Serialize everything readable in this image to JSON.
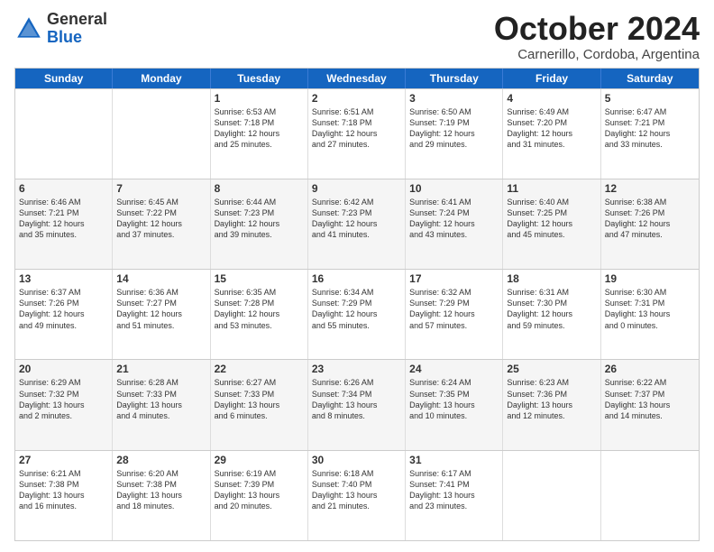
{
  "logo": {
    "general": "General",
    "blue": "Blue"
  },
  "title": "October 2024",
  "subtitle": "Carnerillo, Cordoba, Argentina",
  "days": [
    "Sunday",
    "Monday",
    "Tuesday",
    "Wednesday",
    "Thursday",
    "Friday",
    "Saturday"
  ],
  "weeks": [
    [
      {
        "day": "",
        "detail": ""
      },
      {
        "day": "",
        "detail": ""
      },
      {
        "day": "1",
        "detail": "Sunrise: 6:53 AM\nSunset: 7:18 PM\nDaylight: 12 hours\nand 25 minutes."
      },
      {
        "day": "2",
        "detail": "Sunrise: 6:51 AM\nSunset: 7:18 PM\nDaylight: 12 hours\nand 27 minutes."
      },
      {
        "day": "3",
        "detail": "Sunrise: 6:50 AM\nSunset: 7:19 PM\nDaylight: 12 hours\nand 29 minutes."
      },
      {
        "day": "4",
        "detail": "Sunrise: 6:49 AM\nSunset: 7:20 PM\nDaylight: 12 hours\nand 31 minutes."
      },
      {
        "day": "5",
        "detail": "Sunrise: 6:47 AM\nSunset: 7:21 PM\nDaylight: 12 hours\nand 33 minutes."
      }
    ],
    [
      {
        "day": "6",
        "detail": "Sunrise: 6:46 AM\nSunset: 7:21 PM\nDaylight: 12 hours\nand 35 minutes."
      },
      {
        "day": "7",
        "detail": "Sunrise: 6:45 AM\nSunset: 7:22 PM\nDaylight: 12 hours\nand 37 minutes."
      },
      {
        "day": "8",
        "detail": "Sunrise: 6:44 AM\nSunset: 7:23 PM\nDaylight: 12 hours\nand 39 minutes."
      },
      {
        "day": "9",
        "detail": "Sunrise: 6:42 AM\nSunset: 7:23 PM\nDaylight: 12 hours\nand 41 minutes."
      },
      {
        "day": "10",
        "detail": "Sunrise: 6:41 AM\nSunset: 7:24 PM\nDaylight: 12 hours\nand 43 minutes."
      },
      {
        "day": "11",
        "detail": "Sunrise: 6:40 AM\nSunset: 7:25 PM\nDaylight: 12 hours\nand 45 minutes."
      },
      {
        "day": "12",
        "detail": "Sunrise: 6:38 AM\nSunset: 7:26 PM\nDaylight: 12 hours\nand 47 minutes."
      }
    ],
    [
      {
        "day": "13",
        "detail": "Sunrise: 6:37 AM\nSunset: 7:26 PM\nDaylight: 12 hours\nand 49 minutes."
      },
      {
        "day": "14",
        "detail": "Sunrise: 6:36 AM\nSunset: 7:27 PM\nDaylight: 12 hours\nand 51 minutes."
      },
      {
        "day": "15",
        "detail": "Sunrise: 6:35 AM\nSunset: 7:28 PM\nDaylight: 12 hours\nand 53 minutes."
      },
      {
        "day": "16",
        "detail": "Sunrise: 6:34 AM\nSunset: 7:29 PM\nDaylight: 12 hours\nand 55 minutes."
      },
      {
        "day": "17",
        "detail": "Sunrise: 6:32 AM\nSunset: 7:29 PM\nDaylight: 12 hours\nand 57 minutes."
      },
      {
        "day": "18",
        "detail": "Sunrise: 6:31 AM\nSunset: 7:30 PM\nDaylight: 12 hours\nand 59 minutes."
      },
      {
        "day": "19",
        "detail": "Sunrise: 6:30 AM\nSunset: 7:31 PM\nDaylight: 13 hours\nand 0 minutes."
      }
    ],
    [
      {
        "day": "20",
        "detail": "Sunrise: 6:29 AM\nSunset: 7:32 PM\nDaylight: 13 hours\nand 2 minutes."
      },
      {
        "day": "21",
        "detail": "Sunrise: 6:28 AM\nSunset: 7:33 PM\nDaylight: 13 hours\nand 4 minutes."
      },
      {
        "day": "22",
        "detail": "Sunrise: 6:27 AM\nSunset: 7:33 PM\nDaylight: 13 hours\nand 6 minutes."
      },
      {
        "day": "23",
        "detail": "Sunrise: 6:26 AM\nSunset: 7:34 PM\nDaylight: 13 hours\nand 8 minutes."
      },
      {
        "day": "24",
        "detail": "Sunrise: 6:24 AM\nSunset: 7:35 PM\nDaylight: 13 hours\nand 10 minutes."
      },
      {
        "day": "25",
        "detail": "Sunrise: 6:23 AM\nSunset: 7:36 PM\nDaylight: 13 hours\nand 12 minutes."
      },
      {
        "day": "26",
        "detail": "Sunrise: 6:22 AM\nSunset: 7:37 PM\nDaylight: 13 hours\nand 14 minutes."
      }
    ],
    [
      {
        "day": "27",
        "detail": "Sunrise: 6:21 AM\nSunset: 7:38 PM\nDaylight: 13 hours\nand 16 minutes."
      },
      {
        "day": "28",
        "detail": "Sunrise: 6:20 AM\nSunset: 7:38 PM\nDaylight: 13 hours\nand 18 minutes."
      },
      {
        "day": "29",
        "detail": "Sunrise: 6:19 AM\nSunset: 7:39 PM\nDaylight: 13 hours\nand 20 minutes."
      },
      {
        "day": "30",
        "detail": "Sunrise: 6:18 AM\nSunset: 7:40 PM\nDaylight: 13 hours\nand 21 minutes."
      },
      {
        "day": "31",
        "detail": "Sunrise: 6:17 AM\nSunset: 7:41 PM\nDaylight: 13 hours\nand 23 minutes."
      },
      {
        "day": "",
        "detail": ""
      },
      {
        "day": "",
        "detail": ""
      }
    ]
  ]
}
